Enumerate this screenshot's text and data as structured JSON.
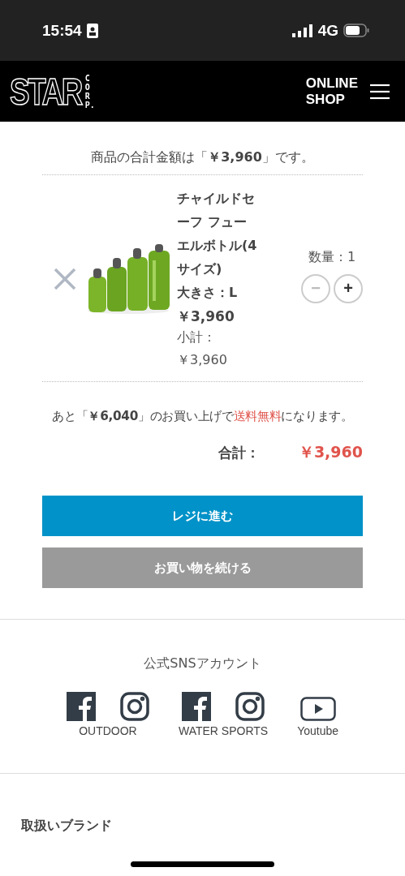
{
  "status_bar": {
    "time": "15:54",
    "network": "4G"
  },
  "header": {
    "logo_main": "STAR",
    "logo_side": "CORP.",
    "shop_label_lines": [
      "ONLINE",
      "SHOP"
    ]
  },
  "cart": {
    "summary": "商品の合計金額は「**￥3,960**」です。",
    "items": [
      {
        "name": "チャイルドセーフ フューエルボトル(4サイズ)",
        "option": "大きさ：L",
        "price": "￥3,960",
        "subtotal_label": "小計：",
        "subtotal": "￥3,960",
        "quantity_label": "数量：1",
        "minus": "−",
        "plus": "+",
        "minus_disabled": true
      }
    ],
    "shipping_note": [
      {
        "text": "あと「**￥6,040**」のお買い上げで",
        "kind": "normal"
      },
      {
        "text": "送料無料",
        "kind": "highlight"
      },
      {
        "text": "になります。",
        "kind": "normal"
      }
    ],
    "total_label": "合計：",
    "total": "￥3,960",
    "buttons": [
      {
        "label": "レジに進む",
        "kind": "primary"
      },
      {
        "label": "お買い物を続ける",
        "kind": "secondary"
      }
    ]
  },
  "sns": {
    "title": "公式SNSアカウント",
    "groups": [
      {
        "label": "OUTDOOR",
        "kind": "social"
      },
      {
        "label": "WATER SPORTS",
        "kind": "social"
      },
      {
        "label": "Youtube",
        "kind": "video"
      }
    ]
  },
  "brands": {
    "title": "取扱いブランド"
  }
}
